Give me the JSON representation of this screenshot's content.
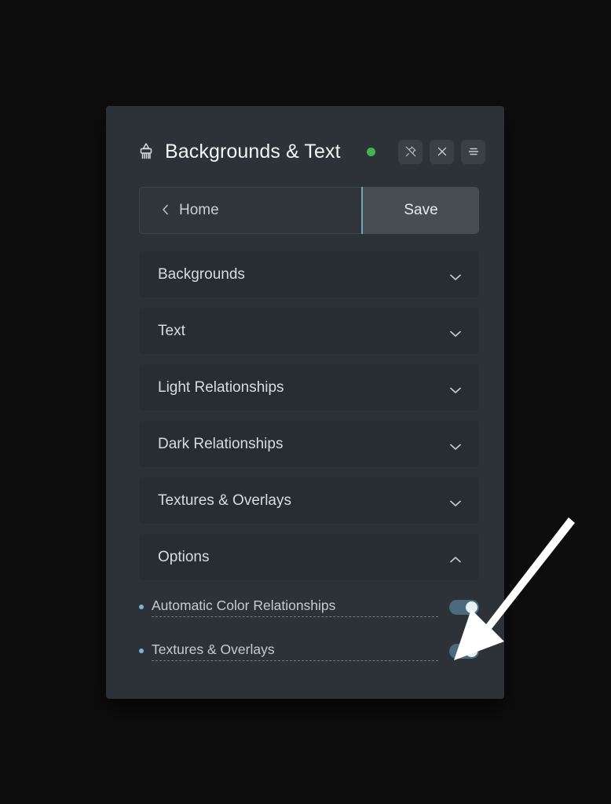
{
  "panel": {
    "title": "Backgrounds & Text",
    "brush_icon": "paintbrush-icon",
    "status_indicator": "status-dot-green",
    "status_color": "#42b54d",
    "header_buttons": [
      {
        "name": "unpin-icon",
        "label": "Unpin"
      },
      {
        "name": "close-icon",
        "label": "Close"
      },
      {
        "name": "menu-icon",
        "label": "Menu"
      }
    ]
  },
  "nav": {
    "back_chevron": "chevron-left-icon",
    "home_label": "Home",
    "save_label": "Save",
    "accent_color": "#6fa9b8"
  },
  "sections": [
    {
      "label": "Backgrounds",
      "state": "collapsed",
      "chevron": "chevron-down-icon"
    },
    {
      "label": "Text",
      "state": "collapsed",
      "chevron": "chevron-down-icon"
    },
    {
      "label": "Light Relationships",
      "state": "collapsed",
      "chevron": "chevron-down-icon"
    },
    {
      "label": "Dark Relationships",
      "state": "collapsed",
      "chevron": "chevron-down-icon"
    },
    {
      "label": "Textures & Overlays",
      "state": "collapsed",
      "chevron": "chevron-down-icon"
    },
    {
      "label": "Options",
      "state": "expanded",
      "chevron": "chevron-up-icon"
    }
  ],
  "options": [
    {
      "label": "Automatic Color Relationships",
      "enabled": "on"
    },
    {
      "label": "Textures & Overlays",
      "enabled": "on"
    }
  ],
  "overlay": {
    "arrow": "pointer-arrow",
    "arrow_color": "#ffffff",
    "points_at": "Textures & Overlays toggle"
  },
  "theme": {
    "page_background": "#0d0d0d",
    "panel_background": "#2c3237",
    "section_background": "#272d32",
    "toggle_track": "#4b6b7c",
    "toggle_knob": "#e7f0f3",
    "bullet_color": "#79b6d3"
  }
}
